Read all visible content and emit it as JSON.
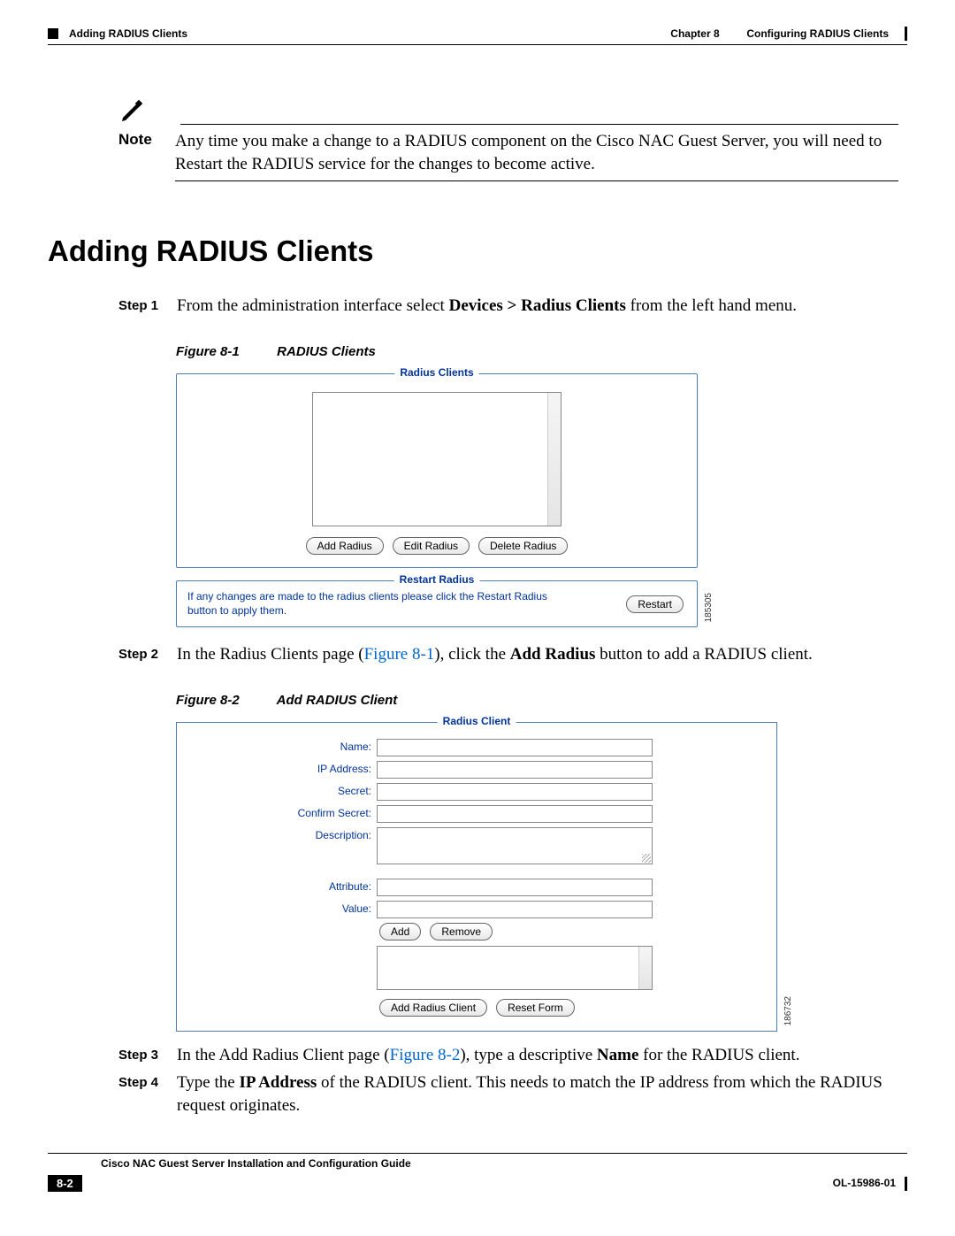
{
  "header": {
    "chapter_ref": "Chapter 8",
    "chapter_title": "Configuring RADIUS Clients",
    "section_running": "Adding RADIUS Clients"
  },
  "note": {
    "label": "Note",
    "text": "Any time you make a change to a RADIUS component on the Cisco NAC Guest Server, you will need to Restart the RADIUS service for the changes to become active."
  },
  "section": {
    "title": "Adding RADIUS Clients"
  },
  "steps": {
    "s1": {
      "label": "Step 1",
      "pre": "From the administration interface select ",
      "bold": "Devices > Radius Clients",
      "post": " from the left hand menu."
    },
    "s2": {
      "label": "Step 2",
      "pre": "In the Radius Clients page (",
      "figref": "Figure 8-1",
      "mid": "), click the ",
      "bold": "Add Radius",
      "post": " button to add a RADIUS client."
    },
    "s3": {
      "label": "Step 3",
      "pre": "In the Add Radius Client page (",
      "figref": "Figure 8-2",
      "mid": "), type a descriptive ",
      "bold": "Name",
      "post": " for the RADIUS client."
    },
    "s4": {
      "label": "Step 4",
      "pre": "Type the ",
      "bold": "IP Address",
      "post": " of the RADIUS client. This needs to match the IP address from which the RADIUS request originates."
    }
  },
  "figure1": {
    "cap_id": "Figure 8-1",
    "cap_title": "RADIUS Clients",
    "legend_main": "Radius Clients",
    "btn_add": "Add Radius",
    "btn_edit": "Edit Radius",
    "btn_delete": "Delete Radius",
    "legend_restart": "Restart Radius",
    "restart_text": "If any changes are made to the radius clients please click the Restart Radius button to apply them.",
    "btn_restart": "Restart",
    "fig_id": "185305"
  },
  "figure2": {
    "cap_id": "Figure 8-2",
    "cap_title": "Add RADIUS Client",
    "legend": "Radius Client",
    "labels": {
      "name": "Name:",
      "ip": "IP Address:",
      "secret": "Secret:",
      "confirm": "Confirm Secret:",
      "desc": "Description:",
      "attr": "Attribute:",
      "value": "Value:"
    },
    "btn_add": "Add",
    "btn_remove": "Remove",
    "btn_add_client": "Add Radius Client",
    "btn_reset": "Reset Form",
    "fig_id": "186732"
  },
  "footer": {
    "guide_title": "Cisco NAC Guest Server Installation and Configuration Guide",
    "page_num": "8-2",
    "doc_id": "OL-15986-01"
  }
}
